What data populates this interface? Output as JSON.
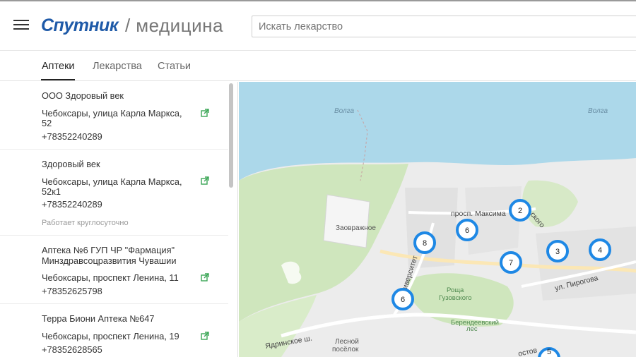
{
  "header": {
    "brand": "Спутник",
    "separator": "/",
    "section": "медицина",
    "search_placeholder": "Искать лекарство"
  },
  "tabs": [
    {
      "label": "Аптеки",
      "active": true
    },
    {
      "label": "Лекарства",
      "active": false
    },
    {
      "label": "Статьи",
      "active": false
    }
  ],
  "pharmacies": [
    {
      "name": "ООО Здоровый век",
      "address": "Чебоксары, улица Карла Маркса, 52",
      "phone": "+78352240289",
      "note": ""
    },
    {
      "name": "Здоровый век",
      "address": "Чебоксары, улица Карла Маркса, 52к1",
      "phone": "+78352240289",
      "note": "Работает круглосуточно"
    },
    {
      "name": "Аптека №6 ГУП ЧР \"Фармация\" Минздравсоцразвития Чувашии",
      "address": "Чебоксары, проспект Ленина, 11",
      "phone": "+78352625798",
      "note": ""
    },
    {
      "name": "Терра Биони Аптека №647",
      "address": "Чебоксары, проспект Ленина, 19",
      "phone": "+78352628565",
      "note": ""
    }
  ],
  "map": {
    "labels": {
      "volga_1": "Волга",
      "volga_2": "Волга",
      "zavrazhnoe": "Заовражное",
      "prospect": "просп. Максима",
      "prospect_tail": "ского",
      "universitet": "ниверситет",
      "pirogova": "ул. Пирогова",
      "roshcha_1": "Роща",
      "roshcha_2": "Гузовского",
      "berend_1": "Берендеевский",
      "berend_2": "лес",
      "yadrinskoe": "Ядринское ш.",
      "lesnoy_1": "Лесной",
      "lesnoy_2": "посёлок",
      "kostov": "остов"
    },
    "clusters": [
      {
        "count": "2"
      },
      {
        "count": "6"
      },
      {
        "count": "8"
      },
      {
        "count": "7"
      },
      {
        "count": "3"
      },
      {
        "count": "4"
      },
      {
        "count": "6"
      },
      {
        "count": "5"
      }
    ],
    "colors": {
      "water": "#acd8ea",
      "land": "#ececec",
      "green": "#cfe6bd",
      "cluster": "#1e88e5"
    }
  }
}
